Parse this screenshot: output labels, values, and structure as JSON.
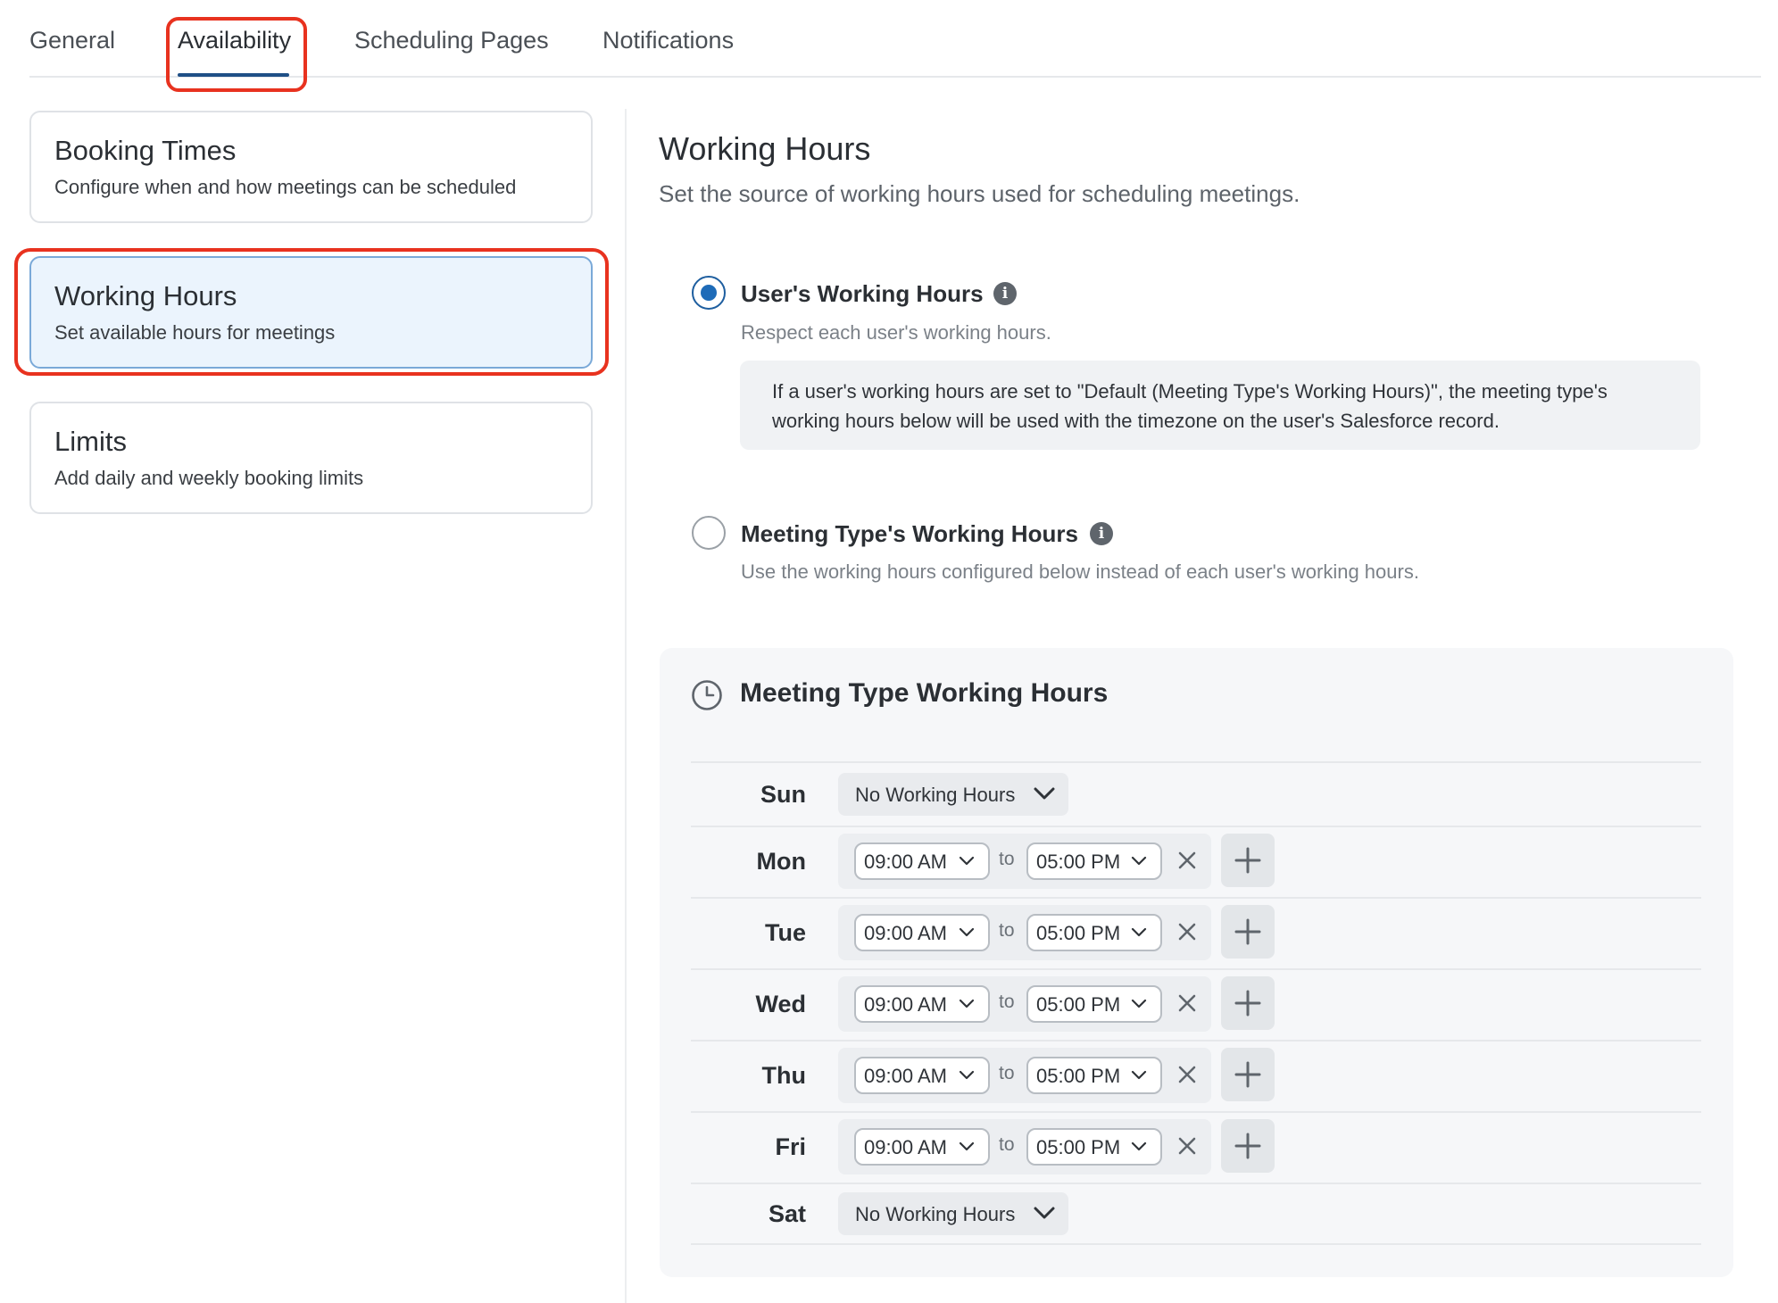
{
  "tabs": [
    {
      "label": "General"
    },
    {
      "label": "Availability"
    },
    {
      "label": "Scheduling Pages"
    },
    {
      "label": "Notifications"
    }
  ],
  "active_tab": "Availability",
  "sidebar": {
    "cards": [
      {
        "title": "Booking Times",
        "description": "Configure when and how meetings can be scheduled"
      },
      {
        "title": "Working Hours",
        "description": "Set available hours for meetings"
      },
      {
        "title": "Limits",
        "description": "Add daily and weekly booking limits"
      }
    ]
  },
  "main": {
    "title": "Working Hours",
    "subtitle": "Set the source of working hours used for scheduling meetings.",
    "options": [
      {
        "label": "User's Working Hours",
        "description": "Respect each user's working hours.",
        "checked": true,
        "note": "If a user's working hours are set to \"Default (Meeting Type's Working Hours)\", the meeting type's working hours below will be used with the timezone on the user's Salesforce record."
      },
      {
        "label": "Meeting Type's Working Hours",
        "description": "Use the working hours configured below instead of each user's working hours.",
        "checked": false
      }
    ],
    "info_glyph": "i",
    "schedule": {
      "title": "Meeting Type Working Hours",
      "to_label": "to",
      "days": [
        {
          "day": "Sun",
          "mode": "none",
          "value": "No Working Hours"
        },
        {
          "day": "Mon",
          "mode": "range",
          "start": "09:00 AM",
          "end": "05:00 PM"
        },
        {
          "day": "Tue",
          "mode": "range",
          "start": "09:00 AM",
          "end": "05:00 PM"
        },
        {
          "day": "Wed",
          "mode": "range",
          "start": "09:00 AM",
          "end": "05:00 PM"
        },
        {
          "day": "Thu",
          "mode": "range",
          "start": "09:00 AM",
          "end": "05:00 PM"
        },
        {
          "day": "Fri",
          "mode": "range",
          "start": "09:00 AM",
          "end": "05:00 PM"
        },
        {
          "day": "Sat",
          "mode": "none",
          "value": "No Working Hours"
        }
      ]
    }
  },
  "colors": {
    "accent": "#1e6bb8",
    "highlight": "#e8321f",
    "selected_card": "#ebf4fd"
  },
  "icons": {
    "info": "info-icon",
    "clock": "clock-icon",
    "dropdown": "chevron-down-icon",
    "remove": "close-icon",
    "add": "plus-icon"
  }
}
